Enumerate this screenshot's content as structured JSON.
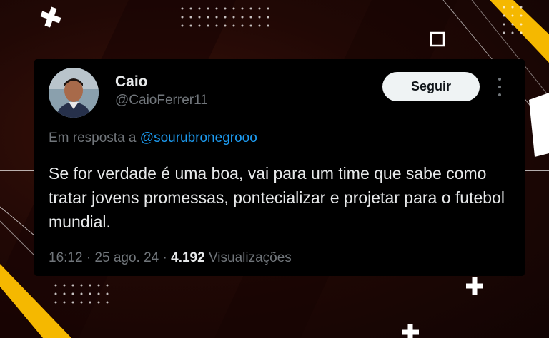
{
  "tweet": {
    "display_name": "Caio",
    "handle": "@CaioFerrer11",
    "follow_label": "Seguir",
    "reply_prefix": "Em resposta a",
    "reply_mention": "@sourubronegrooo",
    "text": "Se for verdade é uma boa, vai para um time que sabe como tratar jovens promessas, pontecializar e projetar para o futebol mundial.",
    "time": "16:12",
    "date": "25 ago. 24",
    "separator": "·",
    "views_count": "4.192",
    "views_label": "Visualizações"
  },
  "colors": {
    "card_bg": "#000000",
    "text_primary": "#e7e9ea",
    "text_secondary": "#71767b",
    "link": "#1d9bf0",
    "follow_bg": "#eff3f4",
    "accent_yellow": "#f5b800",
    "background_red": "#2a0a05"
  },
  "icons": [
    "more-vertical-icon",
    "plus-decoration-icon",
    "square-decoration-icon"
  ]
}
